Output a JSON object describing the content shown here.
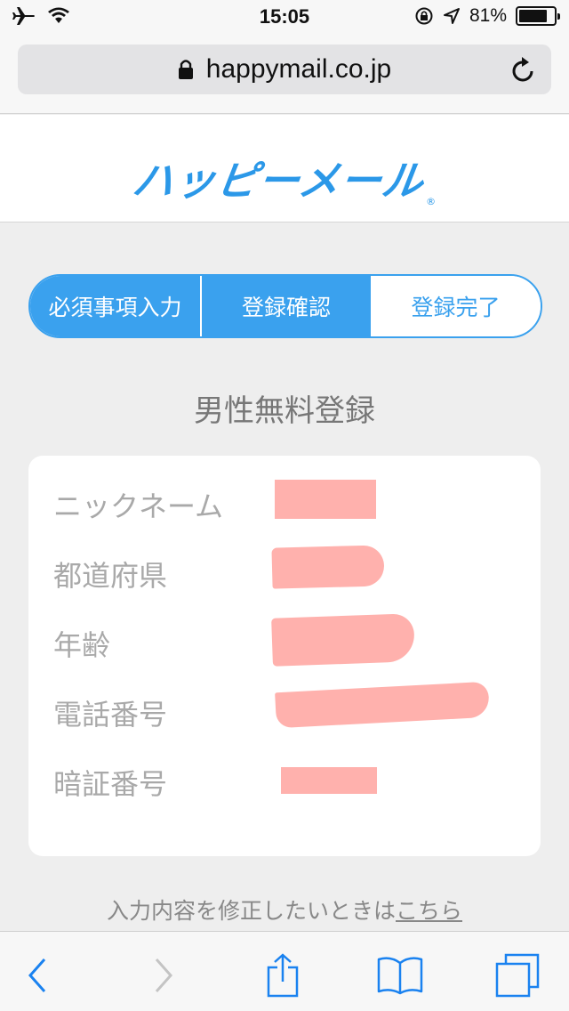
{
  "status_bar": {
    "time": "15:05",
    "battery_percent": "81%",
    "battery_level": 0.81
  },
  "browser": {
    "url": "happymail.co.jp"
  },
  "header": {
    "logo_text": "ハッピーメール",
    "logo_reg": "®"
  },
  "steps": [
    {
      "label": "必須事項入力",
      "state": "done"
    },
    {
      "label": "登録確認",
      "state": "current"
    },
    {
      "label": "登録完了",
      "state": "pending"
    }
  ],
  "page_title": "男性無料登録",
  "form": {
    "rows": [
      {
        "label": "ニックネーム"
      },
      {
        "label": "都道府県"
      },
      {
        "label": "年齢"
      },
      {
        "label": "電話番号"
      },
      {
        "label": "暗証番号"
      }
    ]
  },
  "fix_note": {
    "text": "入力内容を修正したいときは",
    "link": "こちら"
  },
  "colors": {
    "accent": "#3aa1ee",
    "redaction": "#ffb1ad"
  }
}
